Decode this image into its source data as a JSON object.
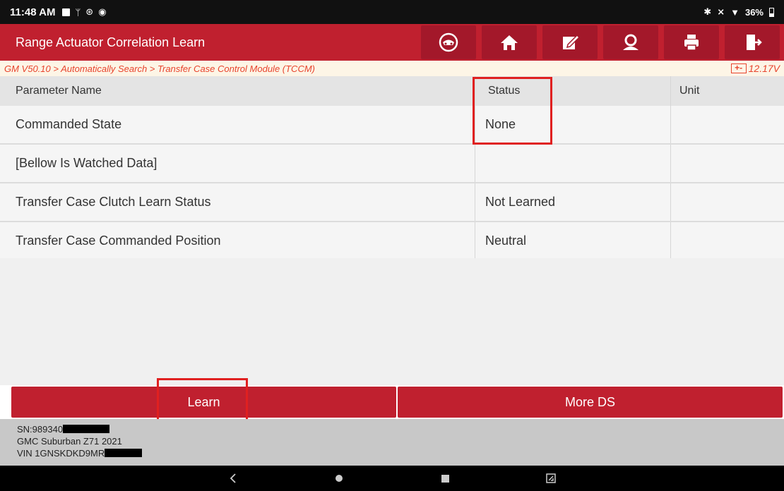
{
  "status_bar": {
    "time": "11:48 AM",
    "battery": "36%"
  },
  "app": {
    "title": "Range Actuator Correlation Learn",
    "toolbar": [
      {
        "name": "vehicle-icon"
      },
      {
        "name": "home-icon"
      },
      {
        "name": "edit-icon"
      },
      {
        "name": "support-icon"
      },
      {
        "name": "print-icon"
      },
      {
        "name": "exit-icon"
      }
    ]
  },
  "breadcrumb": {
    "path": "GM V50.10 > Automatically Search > Transfer Case Control Module (TCCM)",
    "voltage": "12.17V"
  },
  "table": {
    "headers": [
      "Parameter Name",
      "Status",
      "Unit"
    ],
    "rows": [
      [
        "Commanded State",
        "None",
        ""
      ],
      [
        "[Bellow Is Watched Data]",
        "",
        ""
      ],
      [
        "Transfer Case Clutch Learn Status",
        "Not Learned",
        ""
      ],
      [
        "Transfer Case Commanded Position",
        "Neutral",
        ""
      ]
    ]
  },
  "actions": {
    "learn": "Learn",
    "more_ds": "More DS"
  },
  "footer": {
    "sn": "SN:989340",
    "vehicle": "GMC Suburban Z71 2021",
    "vin": "VIN 1GNSKDKD9MR"
  },
  "colors": {
    "accent": "#c0202f",
    "highlight": "#e02020",
    "breadcrumb": "#e8442d"
  }
}
